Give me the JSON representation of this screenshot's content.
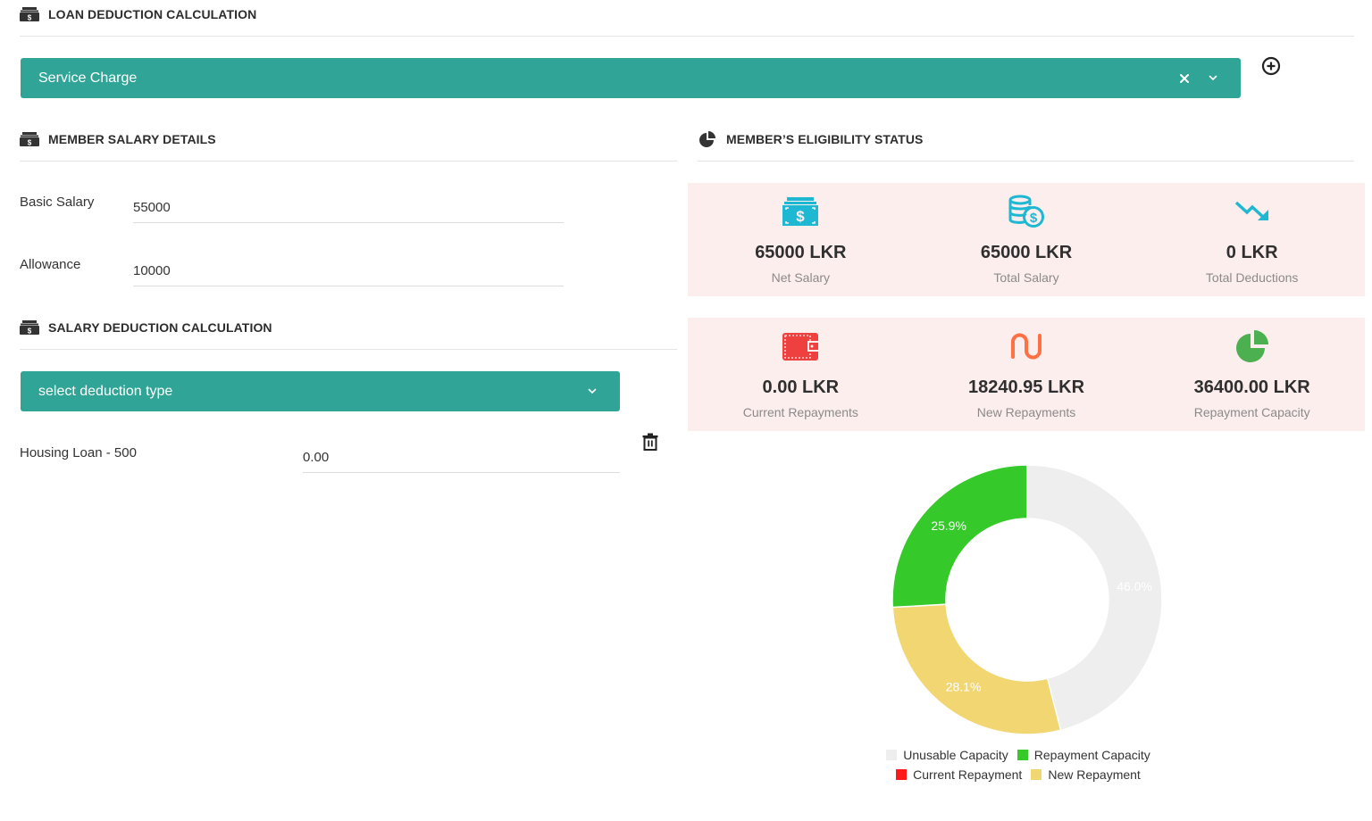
{
  "loan_section": {
    "title": "LOAN DEDUCTION CALCULATION",
    "icon": "money-stack-icon",
    "selected_loan": "Service Charge",
    "clear_icon": "close-icon",
    "dropdown_icon": "chevron-down-icon",
    "add_icon": "plus-circle-icon"
  },
  "salary_section": {
    "title": "MEMBER SALARY DETAILS",
    "icon": "money-stack-icon",
    "fields": [
      {
        "label": "Basic Salary",
        "value": "55000"
      },
      {
        "label": "Allowance",
        "value": "10000"
      }
    ]
  },
  "deduction_section": {
    "title": "SALARY DEDUCTION CALCULATION",
    "icon": "money-stack-icon",
    "select_placeholder": "select deduction type",
    "deductions": [
      {
        "label": "Housing Loan - 500",
        "value": "0.00",
        "delete_icon": "trash-icon"
      }
    ]
  },
  "eligibility_section": {
    "title": "MEMBER’S ELIGIBILITY STATUS",
    "icon": "pie-chart-icon",
    "stats_row1": [
      {
        "value": "65000 LKR",
        "caption": "Net Salary",
        "icon": "cash-icon",
        "color": "#1fb8d3"
      },
      {
        "value": "65000 LKR",
        "caption": "Total Salary",
        "icon": "coins-dollar-icon",
        "color": "#1fb8d3"
      },
      {
        "value": "0 LKR",
        "caption": "Total Deductions",
        "icon": "trend-down-icon",
        "color": "#1fb8d3"
      }
    ],
    "stats_row2": [
      {
        "value": "0.00 LKR",
        "caption": "Current Repayments",
        "icon": "wallet-icon",
        "color": "#ef4040"
      },
      {
        "value": "18240.95 LKR",
        "caption": "New Repayments",
        "icon": "wave-icon",
        "color": "#ff7043"
      },
      {
        "value": "36400.00 LKR",
        "caption": "Repayment Capacity",
        "icon": "pie-chart-icon",
        "color": "#4caf50"
      }
    ]
  },
  "chart_data": {
    "type": "pie",
    "variant": "donut",
    "title": "",
    "series": [
      {
        "name": "Unusable Capacity",
        "value": 46.0,
        "label": "46.0%",
        "color": "#eeeeee"
      },
      {
        "name": "New Repayment",
        "value": 28.1,
        "label": "28.1%",
        "color": "#f2d672"
      },
      {
        "name": "Current Repayment",
        "value": 0.0,
        "label": "",
        "color": "#ff1a1a"
      },
      {
        "name": "Repayment Capacity",
        "value": 25.9,
        "label": "25.9%",
        "color": "#35c92a"
      }
    ],
    "legend": {
      "placement": "bottom",
      "rows": [
        [
          "Unusable Capacity",
          "Repayment Capacity"
        ],
        [
          "Current Repayment",
          "New Repayment"
        ]
      ]
    }
  }
}
